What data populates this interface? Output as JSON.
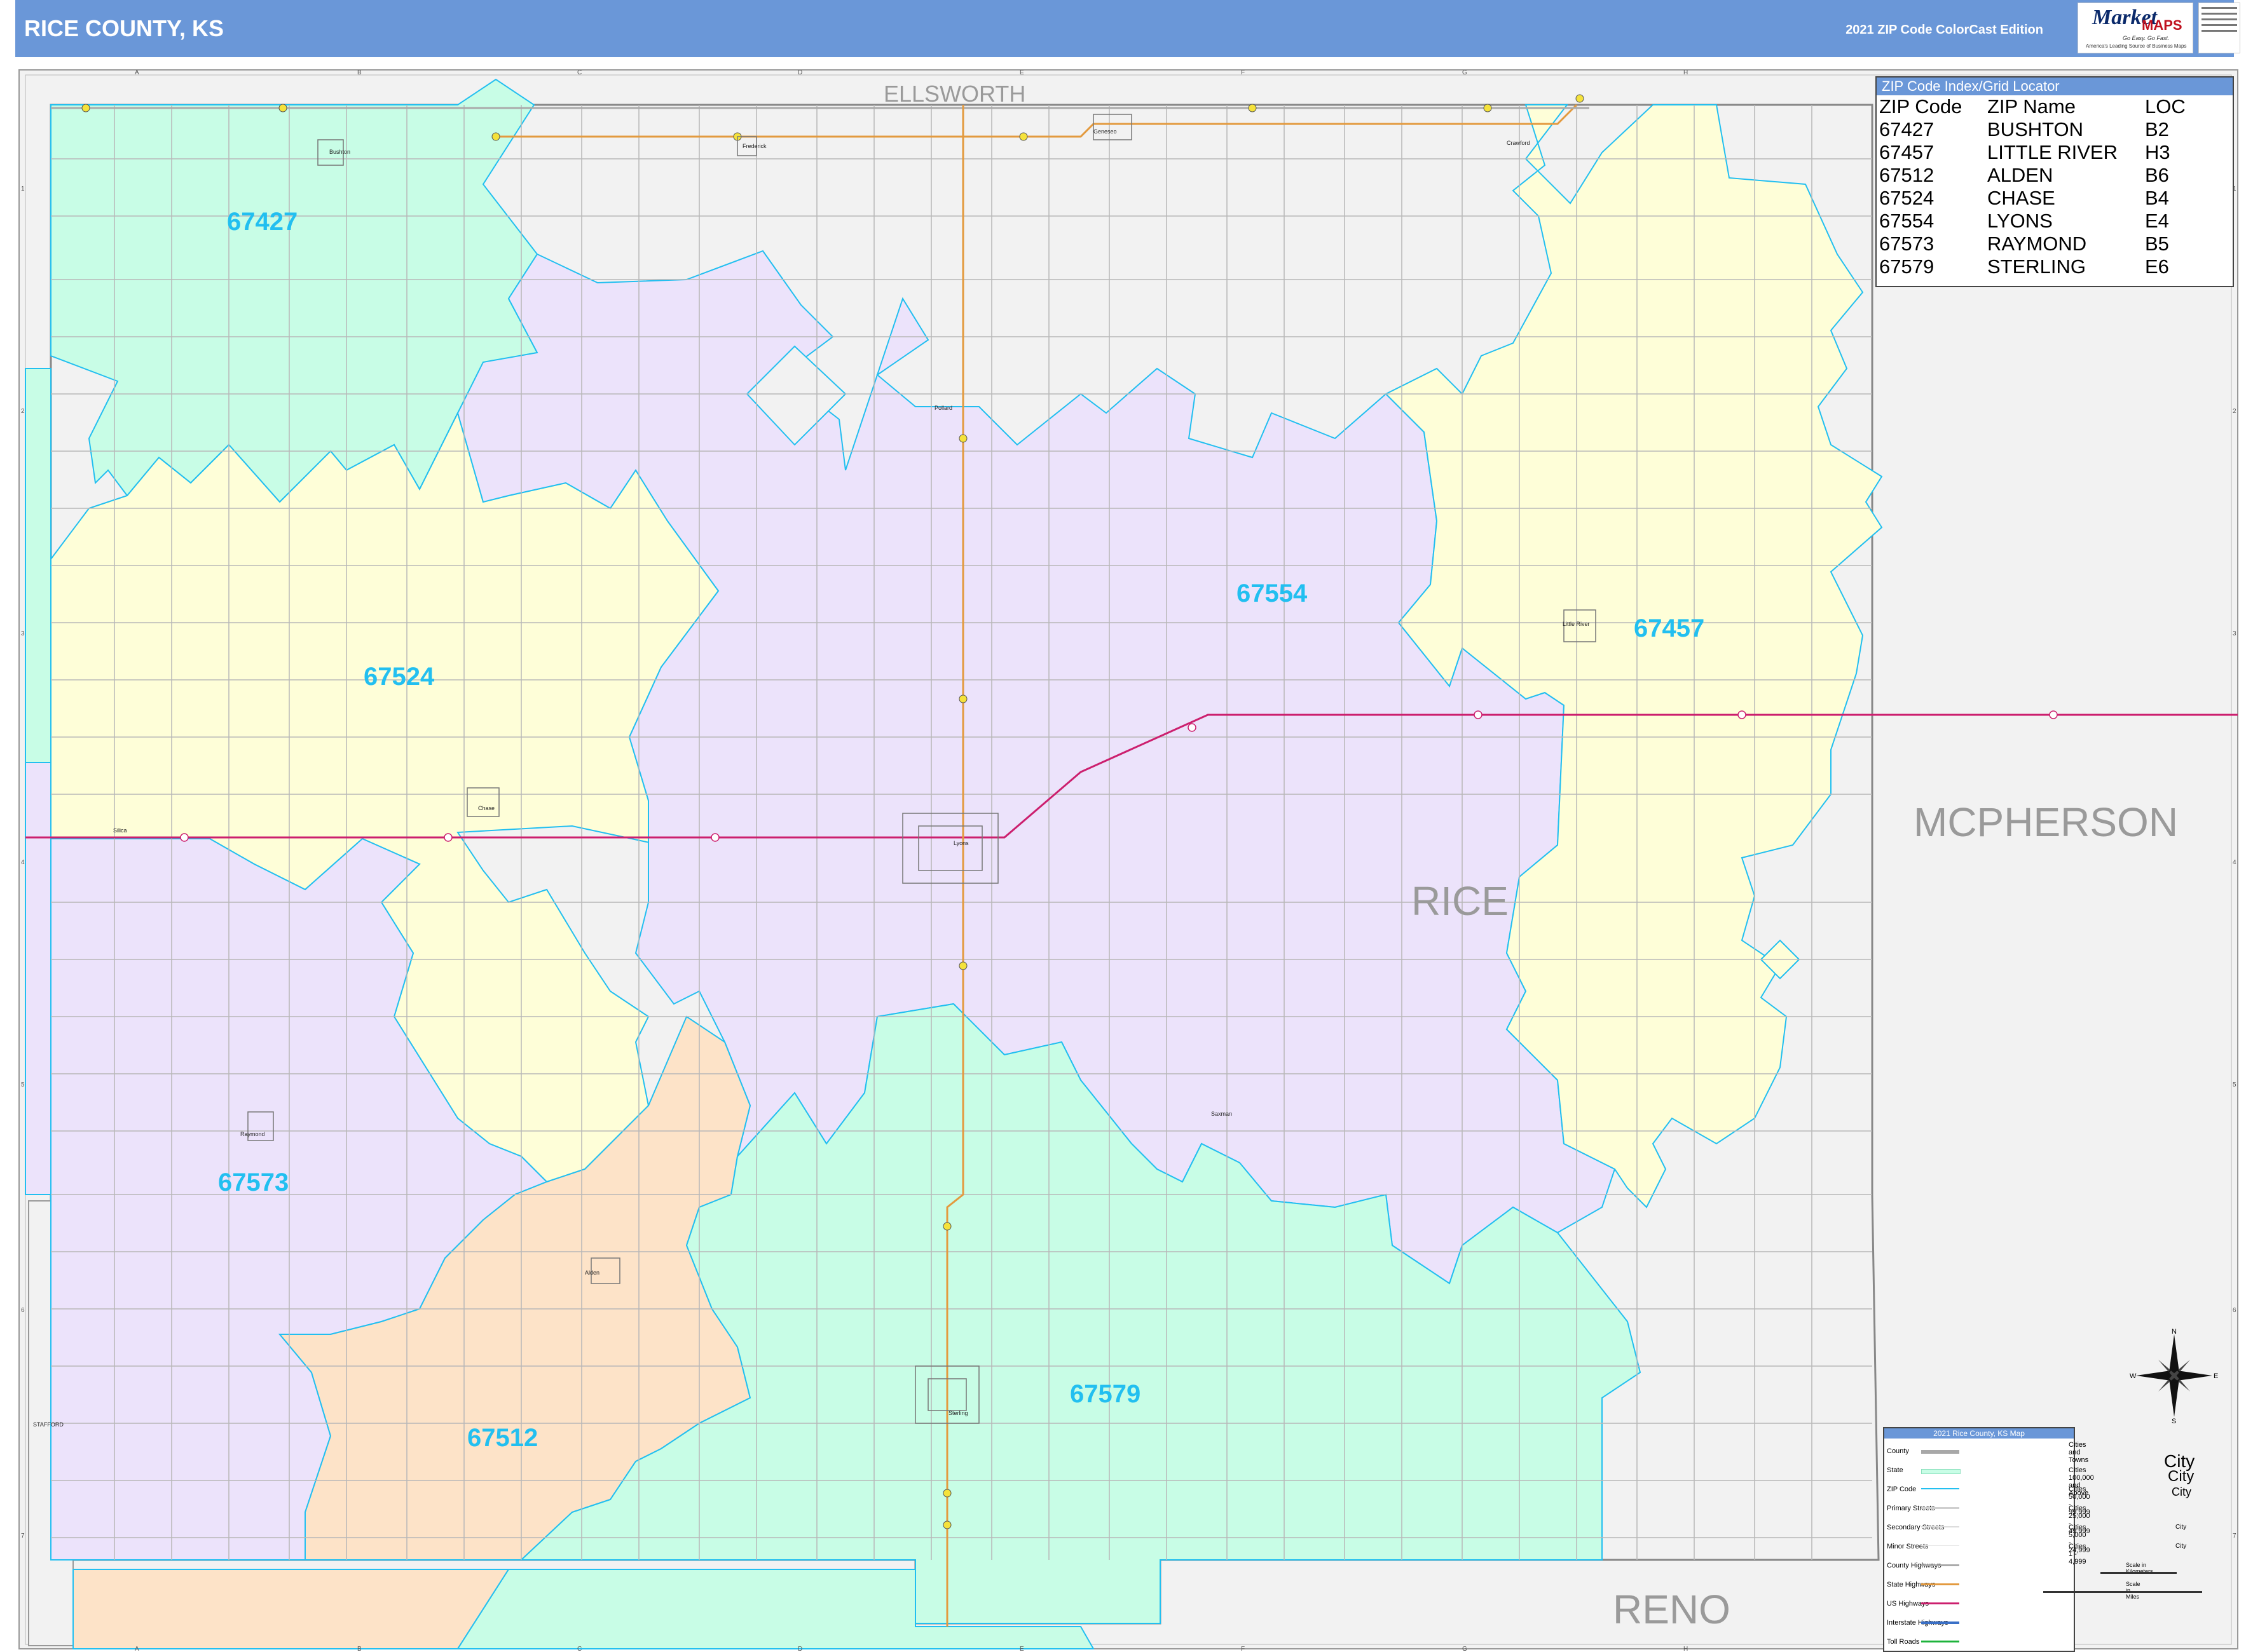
{
  "header": {
    "title": "RICE COUNTY, KS",
    "edition": "2021 ZIP Code ColorCast Edition"
  },
  "logo": {
    "brand_script": "Market",
    "brand_caps": "MAPS",
    "tagline": "Go Easy. Go Fast.",
    "subtagline": "America's Leading Source of Business Maps"
  },
  "colors": {
    "header": "#6a97d8",
    "zip_border": "#22bff0",
    "zip_label": "#22bff0",
    "z67427": "#c8fde6",
    "z67524": "#fefed8",
    "z67554": "#ece3fb",
    "z67457": "#fefed8",
    "z67573": "#ece3fb",
    "z67512": "#fde3c8",
    "z67579": "#c8fde6",
    "outside": "#f2f2f2"
  },
  "map": {
    "neighbor_counties": [
      "ELLSWORTH",
      "MCPHERSON",
      "RENO",
      "STAFFORD"
    ],
    "county_name": "RICE",
    "grid_columns": [
      "A",
      "B",
      "C",
      "D",
      "E",
      "F",
      "G",
      "H"
    ],
    "grid_rows": [
      "1",
      "2",
      "3",
      "4",
      "5",
      "6",
      "7"
    ],
    "zip_labels": [
      "67427",
      "67524",
      "67554",
      "67457",
      "67573",
      "67512",
      "67579"
    ],
    "towns": [
      "Bushton",
      "Frederick",
      "Geneseo",
      "Crawford",
      "Pollard",
      "Little River",
      "Chase",
      "Lyons",
      "Silica",
      "Raymond",
      "Alden",
      "Sterling",
      "Saxman"
    ]
  },
  "zip_index": {
    "title": "ZIP Code Index/Grid Locator",
    "headers": [
      "ZIP Code",
      "ZIP Name",
      "LOC"
    ],
    "rows": [
      [
        "67427",
        "BUSHTON",
        "B2"
      ],
      [
        "67457",
        "LITTLE RIVER",
        "H3"
      ],
      [
        "67512",
        "ALDEN",
        "B6"
      ],
      [
        "67524",
        "CHASE",
        "B4"
      ],
      [
        "67554",
        "LYONS",
        "E4"
      ],
      [
        "67573",
        "RAYMOND",
        "B5"
      ],
      [
        "67579",
        "STERLING",
        "E6"
      ]
    ]
  },
  "legend": {
    "title": "2021 Rice County, KS Map",
    "items": [
      "County",
      "State",
      "ZIP Code",
      "Primary Streets",
      "Secondary Streets",
      "Minor Streets",
      "County Highways",
      "State Highways",
      "US Highways",
      "Interstate Highways",
      "Toll Roads"
    ],
    "cities_header": "Cities and Towns",
    "city_sizes": [
      "Cities 100,000 and Above",
      "Cities 50,000 - 99,999",
      "Cities 25,000 - 49,999",
      "Cities 5,000 - 24,999",
      "Cities 1 - 4,999"
    ],
    "city_word": "City",
    "scale_km": "Scale in Kilometers",
    "scale_mi": "Scale in Miles"
  },
  "compass": {
    "n": "N",
    "s": "S",
    "e": "E",
    "w": "W"
  }
}
